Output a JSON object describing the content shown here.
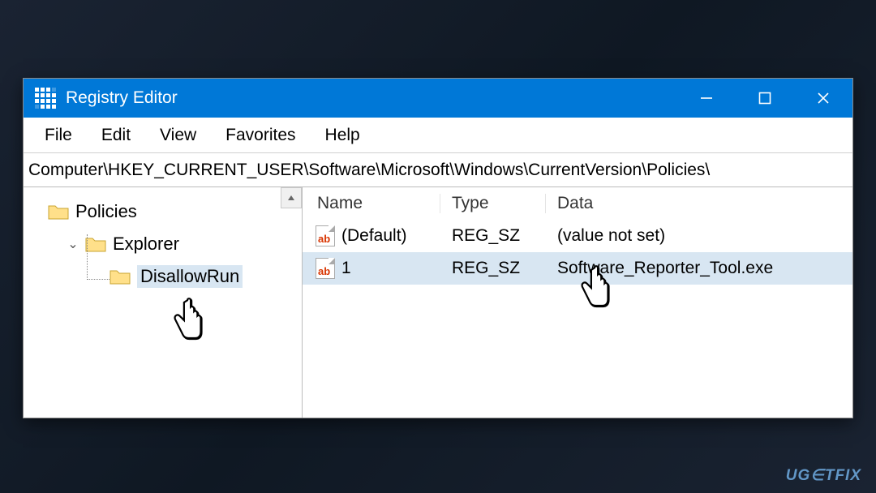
{
  "window": {
    "title": "Registry Editor"
  },
  "menu": {
    "file": "File",
    "edit": "Edit",
    "view": "View",
    "favorites": "Favorites",
    "help": "Help"
  },
  "address": "Computer\\HKEY_CURRENT_USER\\Software\\Microsoft\\Windows\\CurrentVersion\\Policies\\",
  "tree": {
    "node0": "Policies",
    "node1": "Explorer",
    "node2": "DisallowRun"
  },
  "columns": {
    "name": "Name",
    "type": "Type",
    "data": "Data"
  },
  "values": [
    {
      "name": "(Default)",
      "type": "REG_SZ",
      "data": "(value not set)"
    },
    {
      "name": "1",
      "type": "REG_SZ",
      "data": "Software_Reporter_Tool.exe"
    }
  ],
  "watermark": "UG∈TFIX"
}
